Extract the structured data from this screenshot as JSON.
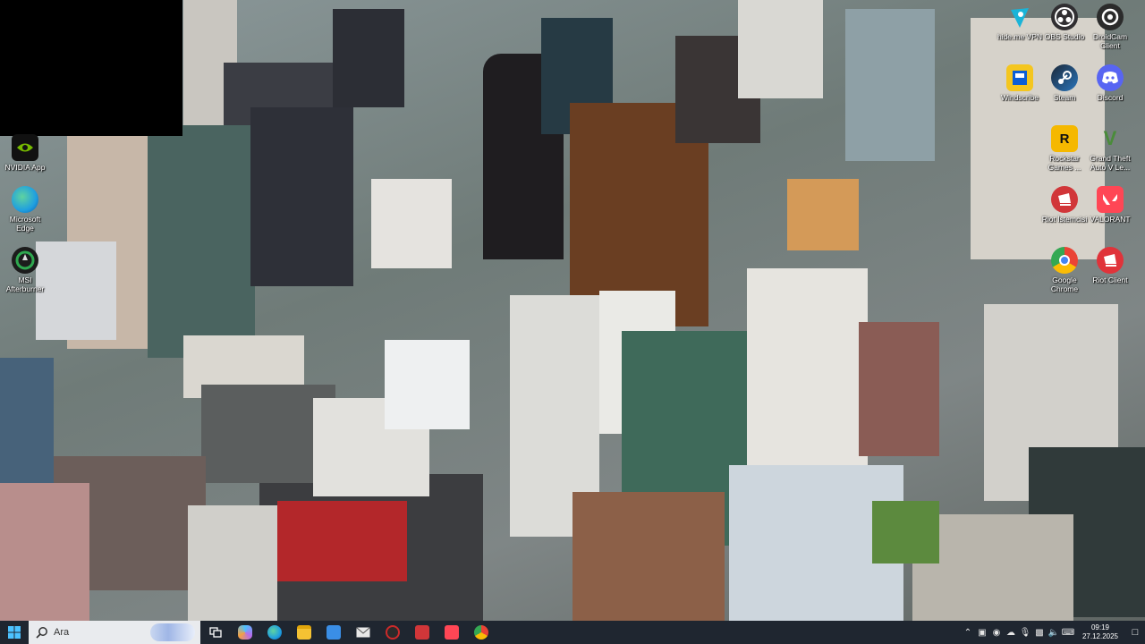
{
  "desktop": {
    "left_icons": [
      {
        "label": "NVIDIA App",
        "icon": "nvidia-icon",
        "color": "#76b900"
      },
      {
        "label": "Microsoft Edge",
        "icon": "edge-icon",
        "color": "#1f9fe0"
      },
      {
        "label": "MSI Afterburner",
        "icon": "afterburner-icon",
        "color": "#2fa84f"
      }
    ],
    "right_icons": [
      {
        "label": "hide.me VPN",
        "icon": "hideme-icon",
        "color": "#1ab4d8"
      },
      {
        "label": "OBS Studio",
        "icon": "obs-icon",
        "color": "#302e31"
      },
      {
        "label": "DroidCam Client",
        "icon": "droidcam-icon",
        "color": "#2b2b2b"
      },
      {
        "label": "Windscribe",
        "icon": "windscribe-icon",
        "color": "#0b5fd6"
      },
      {
        "label": "Steam",
        "icon": "steam-icon",
        "color": "#1b2838"
      },
      {
        "label": "Discord",
        "icon": "discord-icon",
        "color": "#5865f2"
      },
      {
        "label": "Rockstar Games ...",
        "icon": "rockstar-icon",
        "color": "#f5b800"
      },
      {
        "label": "Grand Theft Auto V Le...",
        "icon": "gta-icon",
        "color": "#4a8c3a"
      },
      {
        "label": "Riot İstemcisi",
        "icon": "riot-icon",
        "color": "#d13639"
      },
      {
        "label": "VALORANT",
        "icon": "valorant-icon",
        "color": "#ff4655"
      },
      {
        "label": "Google Chrome",
        "icon": "chrome-icon",
        "color": "#4285f4"
      },
      {
        "label": "Riot Client",
        "icon": "riot-client-icon",
        "color": "#e0333a"
      }
    ]
  },
  "taskbar": {
    "search_placeholder": "Ara",
    "pinned": [
      {
        "name": "task-view-icon",
        "color": "#ffffff"
      },
      {
        "name": "copilot-icon",
        "color": "#b56cf0"
      },
      {
        "name": "edge-taskbar-icon",
        "color": "#1f9fe0"
      },
      {
        "name": "file-explorer-icon",
        "color": "#f4c233"
      },
      {
        "name": "microsoft-store-icon",
        "color": "#3a8ee6"
      },
      {
        "name": "mail-icon",
        "color": "#e8e8e8"
      },
      {
        "name": "obs-taskbar-icon",
        "color": "#cc2a2a"
      },
      {
        "name": "riot-taskbar-icon",
        "color": "#d13639"
      },
      {
        "name": "valorant-taskbar-icon",
        "color": "#ff4655"
      },
      {
        "name": "chrome-taskbar-icon",
        "color": "#4285f4"
      }
    ],
    "clock": {
      "time": "09:19",
      "date": "27.12.2025"
    }
  }
}
